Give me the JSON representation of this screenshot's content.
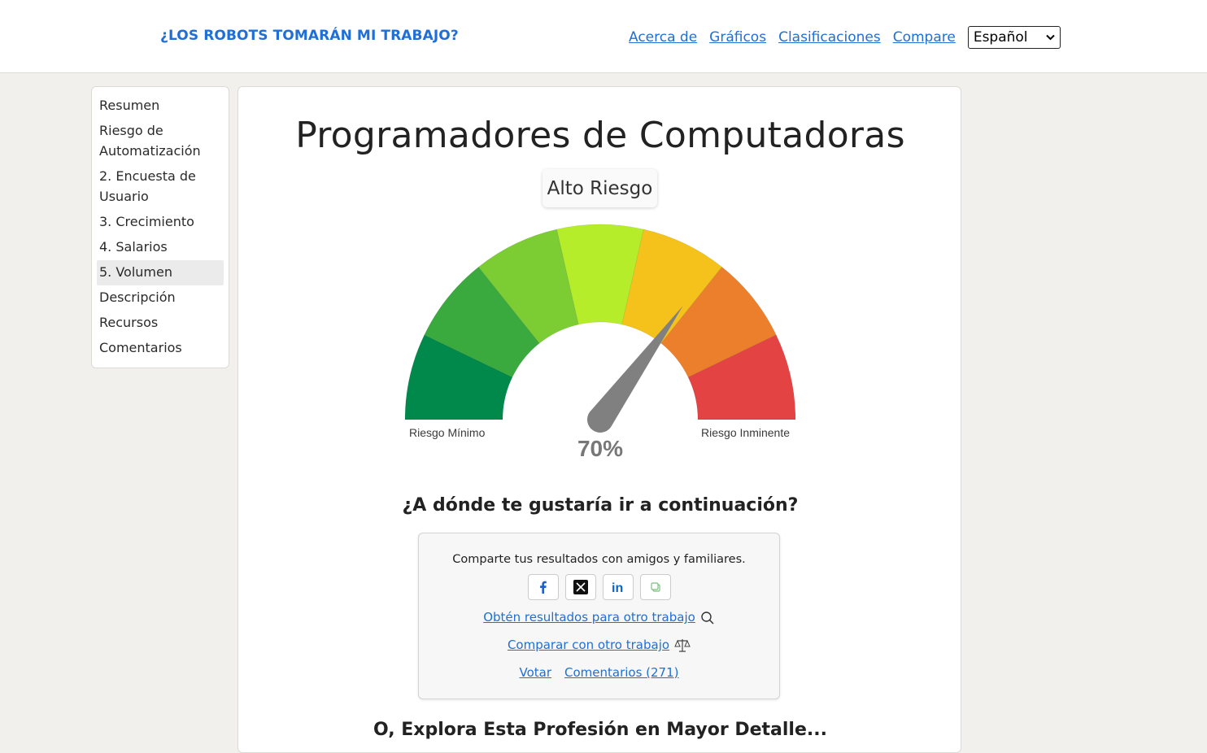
{
  "header": {
    "brand": "¿LOS ROBOTS TOMARÁN MI TRABAJO?",
    "nav": [
      "Acerca de",
      "Gráficos",
      "Clasificaciones",
      "Compare"
    ],
    "language_selected": "Español"
  },
  "sidebar": {
    "items": [
      "Resumen",
      "Riesgo de Automatización",
      "2. Encuesta de Usuario",
      "3. Crecimiento",
      "4. Salarios",
      "5. Volumen",
      "Descripción",
      "Recursos",
      "Comentarios"
    ],
    "active": "5. Volumen"
  },
  "main": {
    "title": "Programadores de Computadoras",
    "risk_label": "Alto Riesgo",
    "gauge": {
      "value_percent": 70,
      "value_text": "70%",
      "min_label": "Riesgo Mínimo",
      "max_label": "Riesgo Inminente",
      "segment_colors": [
        "#00894a",
        "#3aaa3e",
        "#7ccd34",
        "#b6ed2b",
        "#f4c21b",
        "#ec7f2c",
        "#e34343"
      ],
      "needle_color": "#808080"
    },
    "next_heading": "¿A dónde te gustaría ir a continuación?",
    "share": {
      "text": "Comparte tus resultados con amigos y familiares.",
      "buttons": [
        "facebook-icon",
        "x-icon",
        "linkedin-icon",
        "copy-icon"
      ],
      "other_job_link": "Obtén resultados para otro trabajo",
      "compare_link": "Comparar con otro trabajo",
      "vote_link": "Votar",
      "comments_link": "Comentarios (271)"
    },
    "explore_heading": "O, Explora Esta Profesión en Mayor Detalle..."
  }
}
